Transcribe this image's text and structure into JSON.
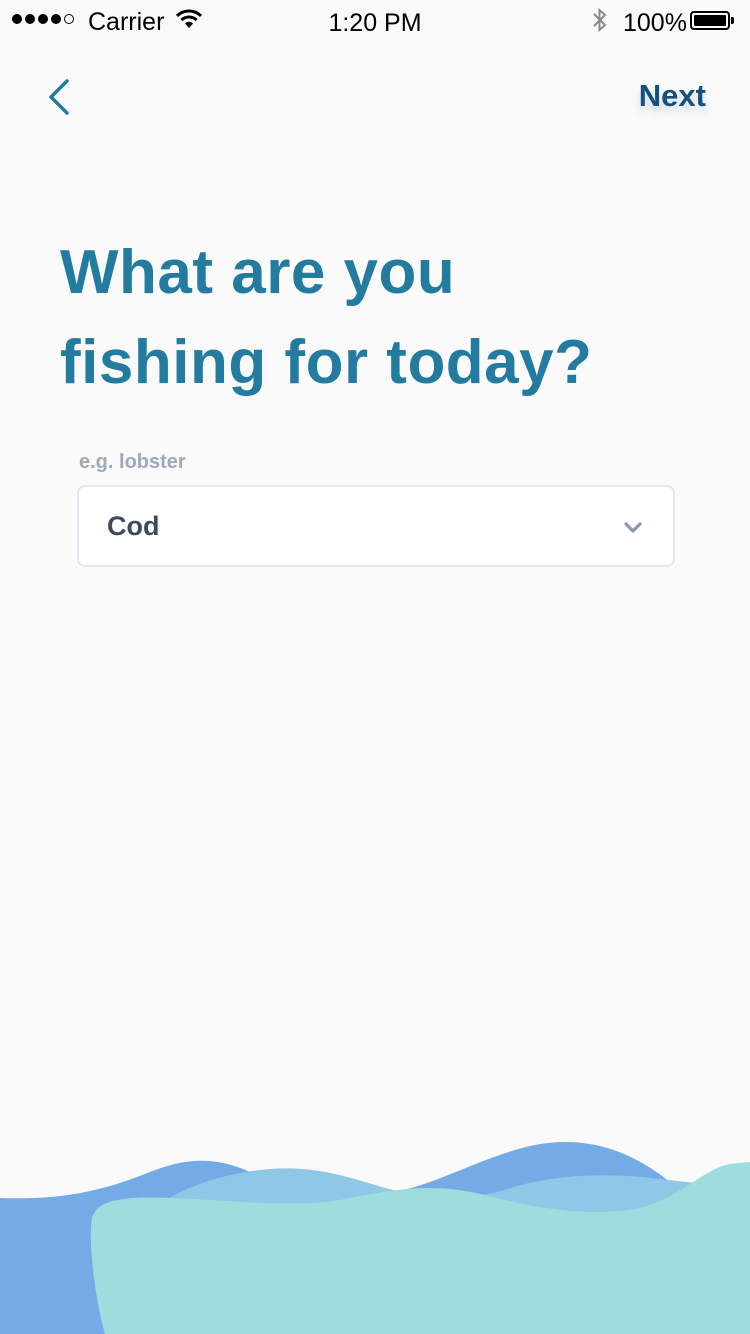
{
  "status_bar": {
    "carrier": "Carrier",
    "time": "1:20 PM",
    "battery": "100%",
    "signal_bars_filled": 4,
    "signal_bars_total": 5
  },
  "nav": {
    "next_label": "Next"
  },
  "heading": {
    "line1": "What are you",
    "line2": "fishing for today?"
  },
  "field": {
    "placeholder_label": "e.g. lobster",
    "value": "Cod"
  },
  "colors": {
    "background": "#fafafa",
    "heading": "#247ba0",
    "next": "#154f7c",
    "wave_back": "#74abe6",
    "wave_mid": "#8ec8e6",
    "wave_front": "#9dddde"
  },
  "icons": {
    "back": "chevron-left-icon",
    "dropdown": "chevron-down-icon",
    "wifi": "wifi-icon",
    "bluetooth": "bluetooth-icon",
    "battery": "battery-icon"
  }
}
